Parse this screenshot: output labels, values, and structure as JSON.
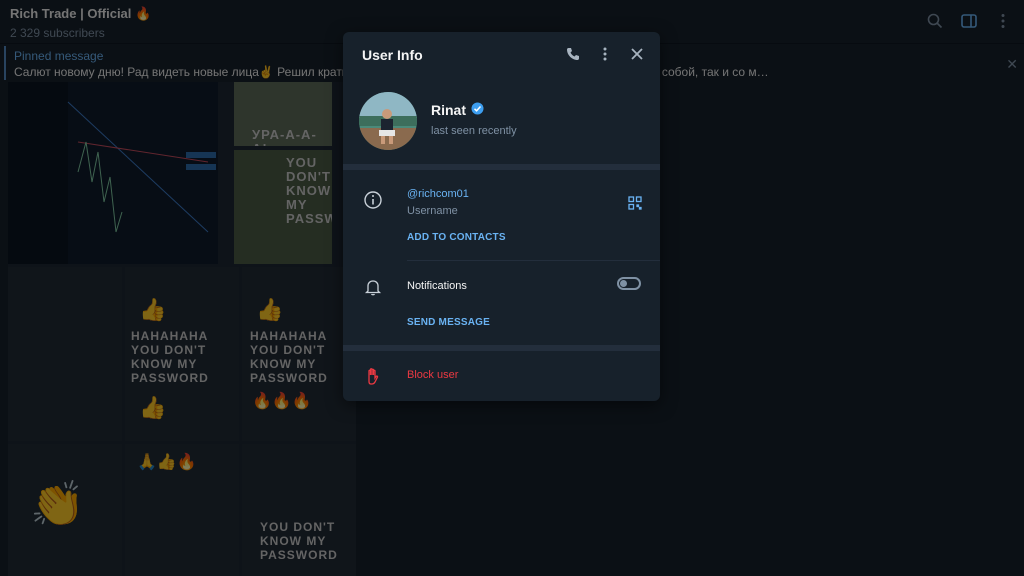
{
  "chat": {
    "title": "Rich Trade | Official 🔥",
    "subscribers": "2 329 subscribers",
    "pinned_title": "Pinned message",
    "pinned_text": "Салют новому дню! Рад видеть новые лица✌️ Решил кратко опис… ат в Telegram, где ребята общаются как между собой, так и со м…",
    "media_words": [
      "УРА-А-А-А!",
      "YOU DON'T KNOW MY PASSWORD",
      "HAHAHAHA YOU DON'T KNOW MY PASSWORD",
      "HAHAHAHA YOU DON'T KNOW MY PASSWORD",
      "YOU DON'T KNOW MY PASSWORD"
    ]
  },
  "modal": {
    "title": "User Info",
    "icons": [
      "phone-icon",
      "more-vertical-icon",
      "close-icon"
    ],
    "name": "Rinat",
    "status": "last seen recently",
    "username": "@richcom01",
    "username_label": "Username",
    "add_contacts": "ADD TO CONTACTS",
    "notifications_label": "Notifications",
    "notifications_on": false,
    "send_message": "SEND MESSAGE",
    "block_user": "Block user"
  },
  "colors": {
    "accent": "#6ab3f3",
    "danger": "#ec3942",
    "panel": "#17212b",
    "muted": "#7f91a4"
  }
}
